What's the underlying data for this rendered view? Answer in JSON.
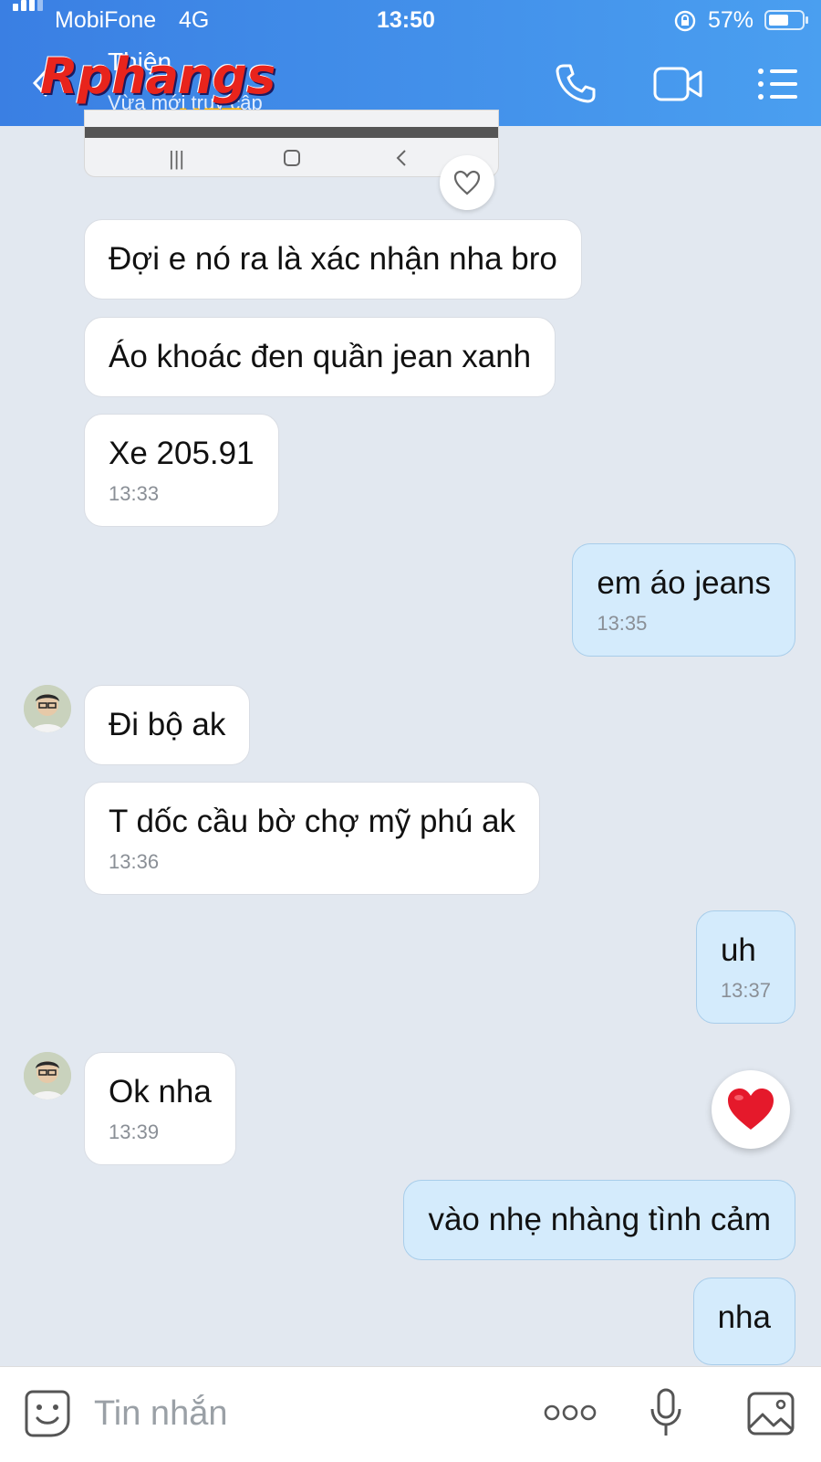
{
  "status_bar": {
    "carrier": "MobiFone",
    "network": "4G",
    "time": "13:50",
    "battery_percent": "57%",
    "battery_level": 0.57
  },
  "header": {
    "contact_name": "Thiện",
    "contact_status": "Vừa mới truy cập",
    "logo_main": "Rphangs",
    "logo_sub": ".NET"
  },
  "messages": [
    {
      "dir": "in",
      "text": "Đợi e nó ra là xác nhận nha bro",
      "time": ""
    },
    {
      "dir": "in",
      "text": "Áo khoác đen quần jean xanh",
      "time": ""
    },
    {
      "dir": "in",
      "text": "Xe 205.91",
      "time": "13:33"
    },
    {
      "dir": "out",
      "text": "em áo jeans",
      "time": "13:35"
    },
    {
      "dir": "in",
      "text": "Đi bộ ak",
      "time": ""
    },
    {
      "dir": "in",
      "text": "T dốc cầu bờ chợ mỹ phú ak",
      "time": "13:36"
    },
    {
      "dir": "out",
      "text": "uh",
      "time": "13:37"
    },
    {
      "dir": "in",
      "text": "Ok nha",
      "time": "13:39"
    },
    {
      "dir": "out",
      "text": "vào nhẹ nhàng tình cảm",
      "time": ""
    },
    {
      "dir": "out",
      "text": "nha",
      "time": ""
    }
  ],
  "composer": {
    "placeholder": "Tin nhắn"
  },
  "colors": {
    "header_start": "#3a7fe3",
    "header_end": "#4a9ff0",
    "outgoing_bubble": "#d4ebfc",
    "incoming_bubble": "#ffffff",
    "background": "#e2e8f0",
    "heart": "#e5192b"
  }
}
